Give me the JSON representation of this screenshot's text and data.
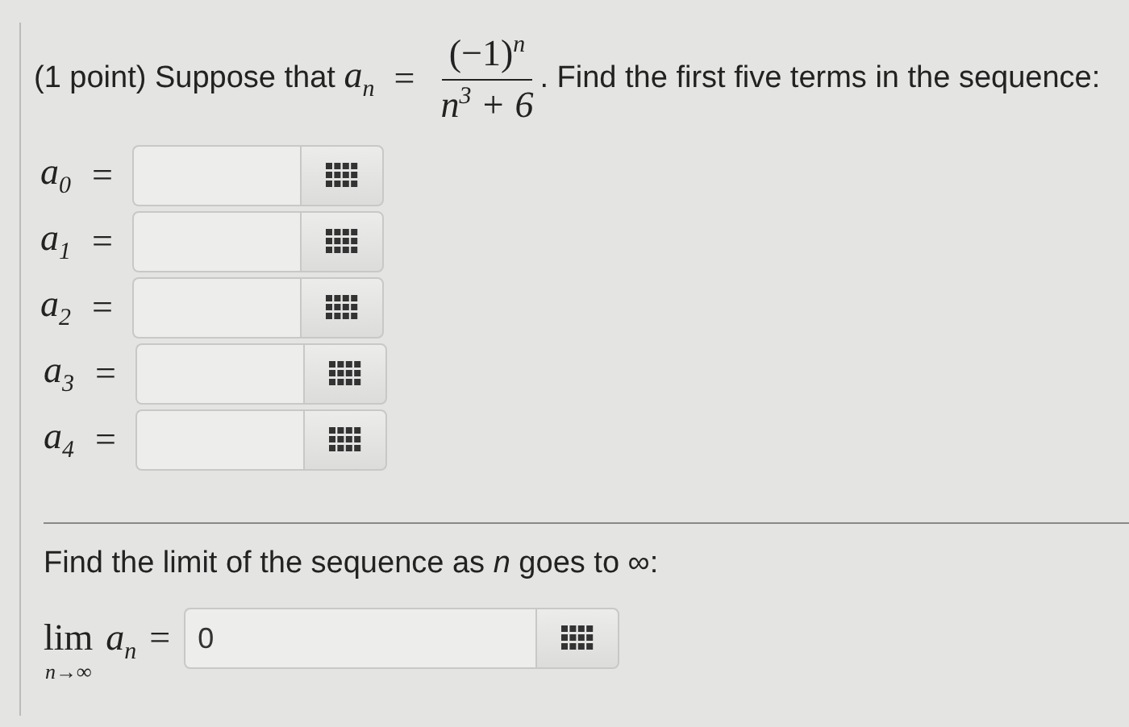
{
  "question": {
    "intro": "(1 point) Suppose that",
    "formula": {
      "lhs": "a$_{n}$",
      "equals": "=",
      "numerator": "(−1)$^{n}$",
      "denominator": "n$^{3}$ + 6"
    },
    "outro": ". Find the first five terms in the sequence:"
  },
  "terms": [
    {
      "label": "a$_{0}$",
      "equals": "="
    },
    {
      "label": "a$_{1}$",
      "equals": "="
    },
    {
      "label": "a$_{2}$",
      "equals": "="
    },
    {
      "label": "a$_{3}$",
      "equals": "="
    },
    {
      "label": "a$_{4}$",
      "equals": "="
    }
  ],
  "limit": {
    "prompt": "Find the limit of the sequence as *n* goes to ∞:",
    "lim": "lim",
    "under": "n→∞",
    "lhs": "a$_{n}$",
    "equals": "=",
    "value": "0"
  }
}
